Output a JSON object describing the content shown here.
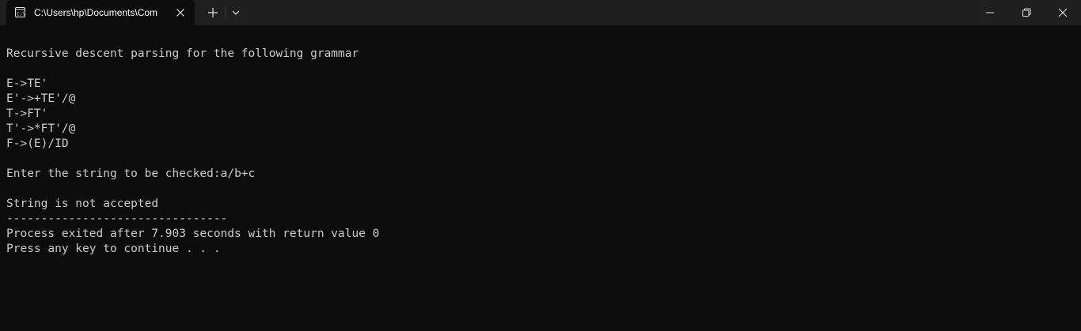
{
  "tab": {
    "title": "C:\\Users\\hp\\Documents\\Com",
    "icon": "console-icon"
  },
  "titlebar": {
    "new_tab_icon": "plus-icon",
    "dropdown_icon": "chevron-down-icon",
    "minimize_icon": "minimize-icon",
    "restore_icon": "restore-icon",
    "close_icon": "close-icon"
  },
  "console": {
    "lines": [
      "Recursive descent parsing for the following grammar",
      "E->TE'",
      "E'->+TE'/@",
      "T->FT'",
      "T'->*FT'/@",
      "F->(E)/ID",
      "Enter the string to be checked:a/b+c",
      "String is not accepted",
      "--------------------------------",
      "Process exited after 7.903 seconds with return value 0",
      "Press any key to continue . . ."
    ]
  },
  "colors": {
    "background": "#0c0c0c",
    "titlebar": "#1f1f1f",
    "text": "#cccccc"
  }
}
